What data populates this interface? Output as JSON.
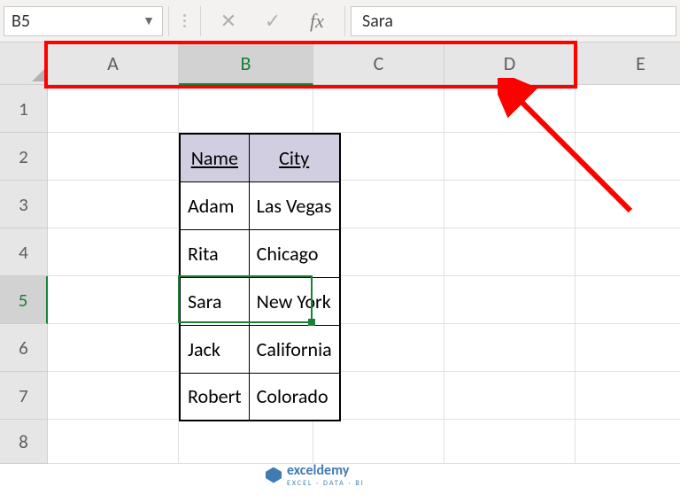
{
  "formula_bar": {
    "cell_ref": "B5",
    "cell_value": "Sara",
    "cancel_icon": "✕",
    "confirm_icon": "✓",
    "fx_label": "fx"
  },
  "columns": [
    {
      "label": "A",
      "width": 148,
      "active": false
    },
    {
      "label": "B",
      "width": 152,
      "active": true
    },
    {
      "label": "C",
      "width": 148,
      "active": false
    },
    {
      "label": "D",
      "width": 148,
      "active": false
    },
    {
      "label": "E",
      "width": 148,
      "active": false
    }
  ],
  "rows": [
    {
      "label": "1",
      "height": 54,
      "active": false
    },
    {
      "label": "2",
      "height": 54,
      "active": false
    },
    {
      "label": "3",
      "height": 54,
      "active": false
    },
    {
      "label": "4",
      "height": 54,
      "active": false
    },
    {
      "label": "5",
      "height": 54,
      "active": true
    },
    {
      "label": "6",
      "height": 54,
      "active": false
    },
    {
      "label": "7",
      "height": 54,
      "active": false
    },
    {
      "label": "8",
      "height": 50,
      "active": false
    }
  ],
  "table": {
    "headers": [
      "Name",
      "City"
    ],
    "data": [
      [
        "Adam",
        "Las Vegas"
      ],
      [
        "Rita",
        "Chicago"
      ],
      [
        "Sara",
        "New York"
      ],
      [
        "Jack",
        "California"
      ],
      [
        "Robert",
        "Colorado"
      ]
    ],
    "top_cell": {
      "col": 1,
      "row": 1
    }
  },
  "active_cell": {
    "col": 1,
    "row": 4
  },
  "watermark": {
    "brand": "exceldemy",
    "tagline": "EXCEL · DATA · BI"
  },
  "highlight": {
    "target": "column-headers"
  }
}
